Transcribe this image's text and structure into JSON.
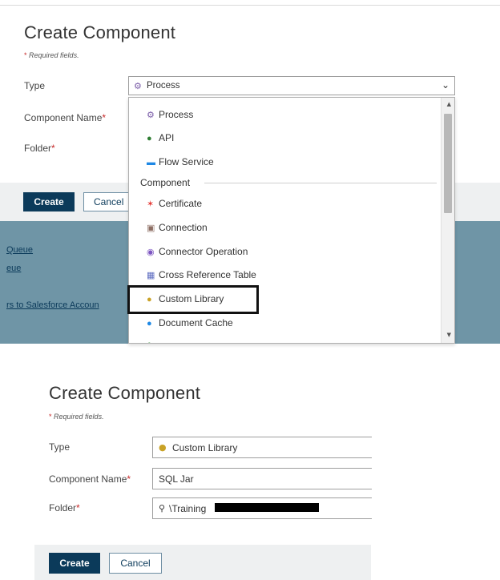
{
  "panel_top": {
    "title": "Create Component",
    "required_note": "Required fields.",
    "type_label": "Type",
    "type_value": "Process",
    "component_name_label": "Component Name",
    "folder_label": "Folder",
    "create_label": "Create",
    "cancel_label": "Cancel",
    "background_links": [
      "Queue",
      "eue",
      "rs to Salesforce Accoun"
    ],
    "dropdown": {
      "items_top": [
        {
          "label": "Process",
          "icon": "process-icon"
        },
        {
          "label": "API",
          "icon": "api-icon"
        },
        {
          "label": "Flow Service",
          "icon": "flow-service-icon"
        }
      ],
      "group_label": "Component",
      "items_component": [
        {
          "label": "Certificate",
          "icon": "certificate-icon"
        },
        {
          "label": "Connection",
          "icon": "connection-icon"
        },
        {
          "label": "Connector Operation",
          "icon": "connector-operation-icon"
        },
        {
          "label": "Cross Reference Table",
          "icon": "table-icon"
        },
        {
          "label": "Custom Library",
          "icon": "custom-library-icon"
        },
        {
          "label": "Document Cache",
          "icon": "document-cache-icon"
        }
      ],
      "highlighted_item": "Custom Library"
    }
  },
  "panel_bottom": {
    "title": "Create Component",
    "required_note": "Required fields.",
    "type_label": "Type",
    "type_value": "Custom Library",
    "component_name_label": "Component Name",
    "component_name_value": "SQL Jar",
    "folder_label": "Folder",
    "folder_value": "\\Training",
    "create_label": "Create",
    "cancel_label": "Cancel"
  },
  "colors": {
    "primary_button": "#0b3a5a",
    "required_star": "#c62828",
    "overlay_background": "#6f95a6"
  }
}
